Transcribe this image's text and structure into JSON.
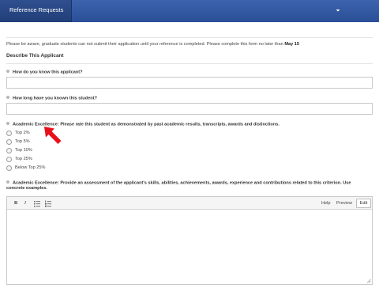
{
  "topbar": {
    "tab_label": "Reference Requests",
    "icons": {
      "menu": "caret-down-icon"
    }
  },
  "notice": {
    "text": "Please be aware, graduate students can not submit their application until your reference is completed. Please complete this form no later than",
    "deadline": "May 15"
  },
  "section": {
    "title": "Describe This Applicant"
  },
  "questions": {
    "know": {
      "label": "How do you know this applicant?",
      "value": ""
    },
    "how_long": {
      "label": "How long have you known this student?",
      "value": ""
    },
    "academic_rating": {
      "label": "Academic Excellence: Please rate this student as demonstrated by past academic results, transcripts, awards and distinctions.",
      "options": [
        "Top 2%",
        "Top 5%",
        "Top 10%",
        "Top 25%",
        "Below Top 25%"
      ],
      "selected": ""
    },
    "academic_assessment": {
      "label_line1": "Academic Excellence: Provide an assessment of the applicant's skills, abilities, achievements, awards, experience and contributions related to this criterion. Use",
      "label_line2": "concrete examples.",
      "value": ""
    }
  },
  "editor": {
    "toolbar": {
      "bold": "B",
      "italic": "I",
      "help_label": "Help",
      "preview_label": "Preview",
      "edit_label": "Edit"
    },
    "icons": {
      "bullet_list": "bulleted-list-icon",
      "numbered_list": "numbered-list-icon",
      "resize": "resize-grip-icon"
    }
  },
  "annotation": {
    "icon": "red-arrow-icon",
    "color": "#e8101b"
  },
  "colors": {
    "header_blue": "#2f56a0",
    "tab_blue": "#26447f"
  }
}
